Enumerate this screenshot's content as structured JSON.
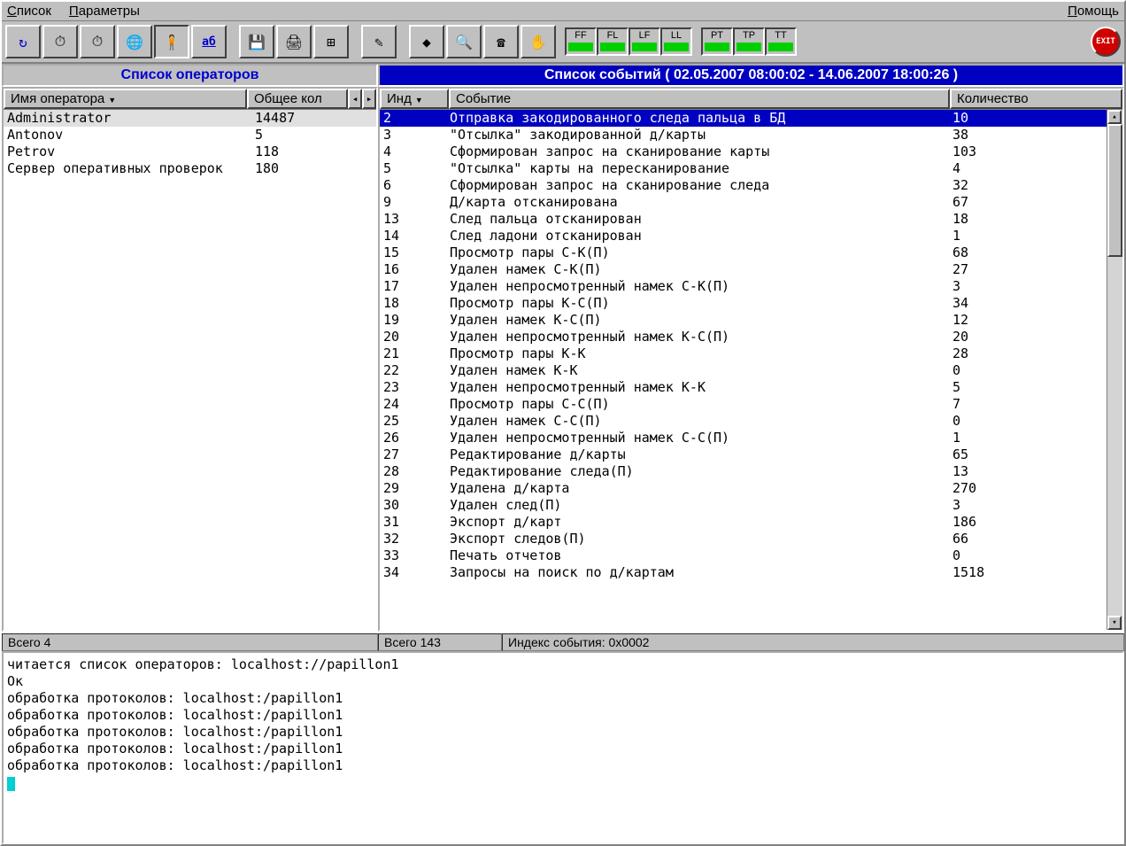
{
  "menu": {
    "list": "Список",
    "params": "Параметры",
    "help": "Помощь"
  },
  "indicators": [
    "FF",
    "FL",
    "LF",
    "LL",
    "PT",
    "TP",
    "TT"
  ],
  "titles": {
    "operators": "Список операторов",
    "events": "Список событий ( 02.05.2007 08:00:02 - 14.06.2007 18:00:26 )"
  },
  "op_cols": {
    "name": "Имя оператора",
    "count": "Общее кол"
  },
  "ev_cols": {
    "ind": "Инд",
    "event": "Событие",
    "count": "Количество"
  },
  "operators": [
    {
      "name": "Administrator",
      "count": "14487",
      "selected": true
    },
    {
      "name": "Antonov",
      "count": "5"
    },
    {
      "name": "Petrov",
      "count": "118"
    },
    {
      "name": "Сервер оперативных проверок",
      "count": "180"
    }
  ],
  "events": [
    {
      "ind": "2",
      "name": "Отправка закодированного следа пальца в БД",
      "count": "10",
      "selected": true
    },
    {
      "ind": "3",
      "name": "\"Отсылка\" закодированной д/карты",
      "count": "38"
    },
    {
      "ind": "4",
      "name": "Сформирован запрос на сканирование карты",
      "count": "103"
    },
    {
      "ind": "5",
      "name": "\"Отсылка\" карты на пересканирование",
      "count": "4"
    },
    {
      "ind": "6",
      "name": "Сформирован запрос на сканирование следа",
      "count": "32"
    },
    {
      "ind": "9",
      "name": "Д/карта отсканирована",
      "count": "67"
    },
    {
      "ind": "13",
      "name": "След пальца отсканирован",
      "count": "18"
    },
    {
      "ind": "14",
      "name": "След ладони отсканирован",
      "count": "1"
    },
    {
      "ind": "15",
      "name": "Просмотр пары С-К(П)",
      "count": "68"
    },
    {
      "ind": "16",
      "name": "Удален намек С-К(П)",
      "count": "27"
    },
    {
      "ind": "17",
      "name": "Удален непросмотренный намек С-К(П)",
      "count": "3"
    },
    {
      "ind": "18",
      "name": "Просмотр пары К-С(П)",
      "count": "34"
    },
    {
      "ind": "19",
      "name": "Удален намек К-С(П)",
      "count": "12"
    },
    {
      "ind": "20",
      "name": "Удален непросмотренный намек К-С(П)",
      "count": "20"
    },
    {
      "ind": "21",
      "name": "Просмотр пары К-К",
      "count": "28"
    },
    {
      "ind": "22",
      "name": "Удален намек К-К",
      "count": "0"
    },
    {
      "ind": "23",
      "name": "Удален непросмотренный намек К-К",
      "count": "5"
    },
    {
      "ind": "24",
      "name": "Просмотр пары С-С(П)",
      "count": "7"
    },
    {
      "ind": "25",
      "name": "Удален намек С-С(П)",
      "count": "0"
    },
    {
      "ind": "26",
      "name": "Удален непросмотренный намек С-С(П)",
      "count": "1"
    },
    {
      "ind": "27",
      "name": "Редактирование д/карты",
      "count": "65"
    },
    {
      "ind": "28",
      "name": "Редактирование следа(П)",
      "count": "13"
    },
    {
      "ind": "29",
      "name": "Удалена д/карта",
      "count": "270"
    },
    {
      "ind": "30",
      "name": "Удален след(П)",
      "count": "3"
    },
    {
      "ind": "31",
      "name": "Экспорт д/карт",
      "count": "186"
    },
    {
      "ind": "32",
      "name": "Экспорт следов(П)",
      "count": "66"
    },
    {
      "ind": "33",
      "name": "Печать отчетов",
      "count": "0"
    },
    {
      "ind": "34",
      "name": "Запросы на поиск по д/картам",
      "count": "1518"
    }
  ],
  "status": {
    "op_total": "Всего 4",
    "ev_total": "Всего 143",
    "ev_index": "Индекс события: 0x0002"
  },
  "log": [
    "читается список операторов: localhost://papillon1",
    "Ок",
    "обработка протоколов: localhost:/papillon1",
    "обработка протоколов: localhost:/papillon1",
    "обработка протоколов: localhost:/papillon1",
    "обработка протоколов: localhost:/papillon1",
    "обработка протоколов: localhost:/papillon1"
  ],
  "tool_icons": [
    "↻",
    "⏱",
    "⏱",
    "🌐",
    "🧍",
    "аб",
    "💾",
    "🖨",
    "⊞",
    "✎",
    "◆",
    "🔍",
    "☎",
    "✋"
  ],
  "exit_label": "EXIT"
}
